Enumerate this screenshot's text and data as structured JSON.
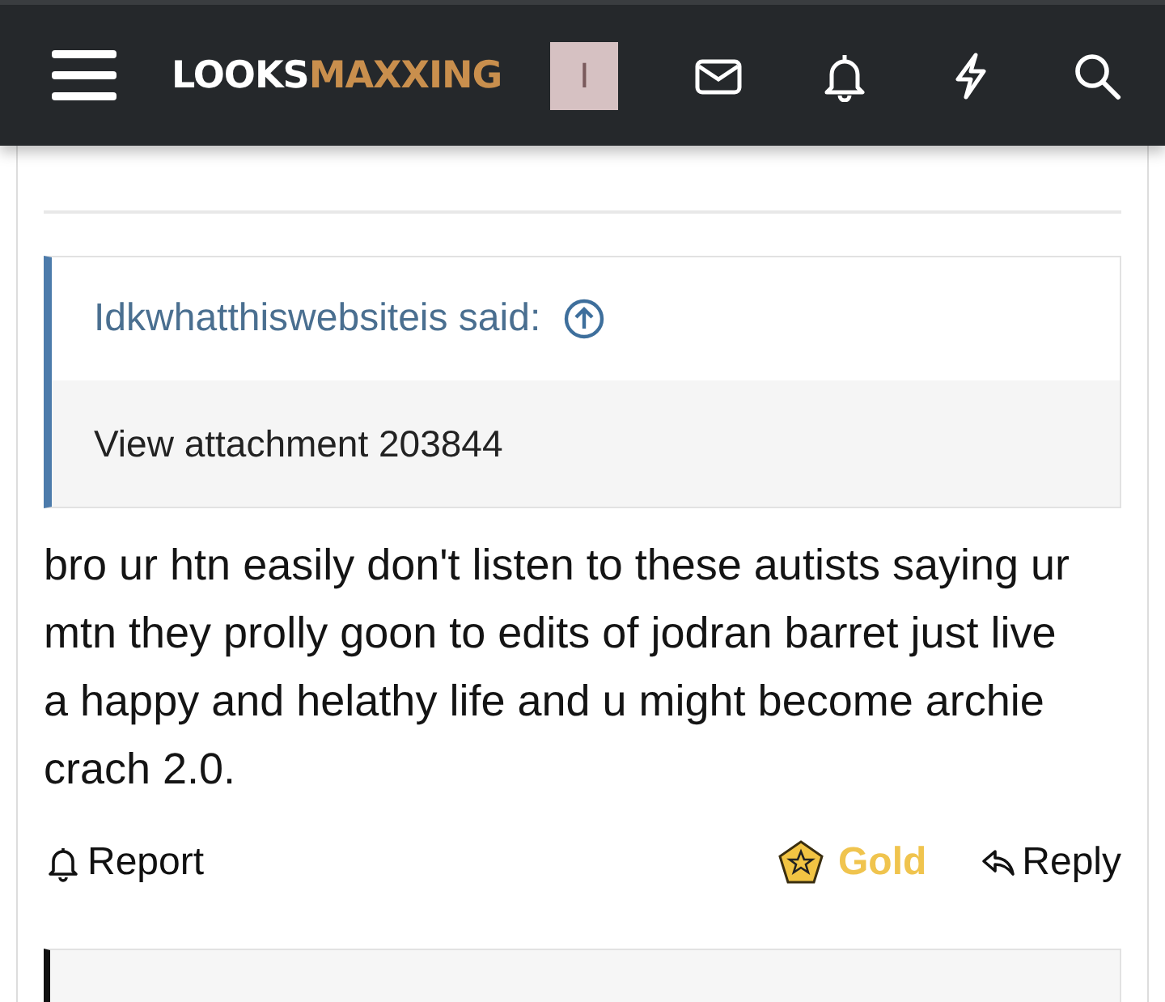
{
  "header": {
    "logo_light": "LOOKS",
    "logo_accent": "MAXXING",
    "avatar_letter": "I"
  },
  "quote": {
    "author": "Idkwhatthiswebsiteis said:",
    "body": "View attachment 203844"
  },
  "post": {
    "text": "bro ur htn easily don't listen to these autists saying ur mtn they prolly goon to edits of jodran barret just live a happy and helathy life and u might become archie crach 2.0."
  },
  "actions": {
    "report": "Report",
    "badge": "Gold",
    "reply": "Reply"
  }
}
